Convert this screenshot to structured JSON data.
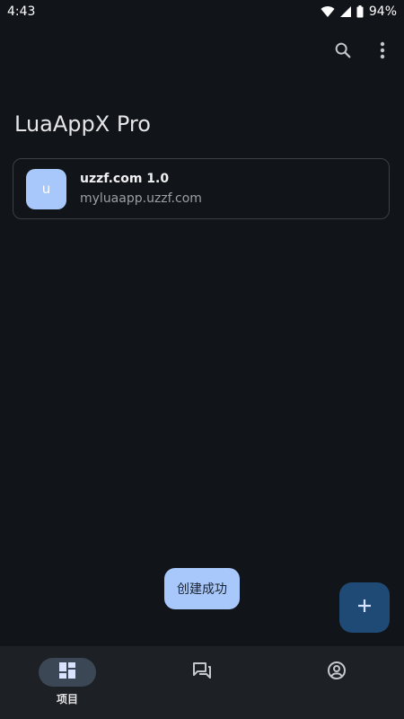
{
  "status_bar": {
    "time": "4:43",
    "battery": "94%",
    "icons": [
      "wifi-icon",
      "signal-icon",
      "battery-icon"
    ]
  },
  "toolbar": {
    "icons": [
      "search-icon",
      "more-vert-icon"
    ]
  },
  "page": {
    "title": "LuaAppX Pro"
  },
  "projects": [
    {
      "avatar_letter": "u",
      "name": "uzzf.com 1.0",
      "url": "myluaapp.uzzf.com"
    }
  ],
  "toast": {
    "message": "创建成功"
  },
  "fab": {
    "icon": "add-icon"
  },
  "bottom_nav": {
    "items": [
      {
        "label": "项目",
        "icon": "dashboard-icon",
        "active": true
      },
      {
        "label": "",
        "icon": "forum-icon",
        "active": false
      },
      {
        "label": "",
        "icon": "account-circle-icon",
        "active": false
      }
    ]
  },
  "colors": {
    "background": "#111418",
    "accent": "#a8c7fa",
    "fab": "#1f4a76",
    "nav_bar": "#1d2024"
  }
}
